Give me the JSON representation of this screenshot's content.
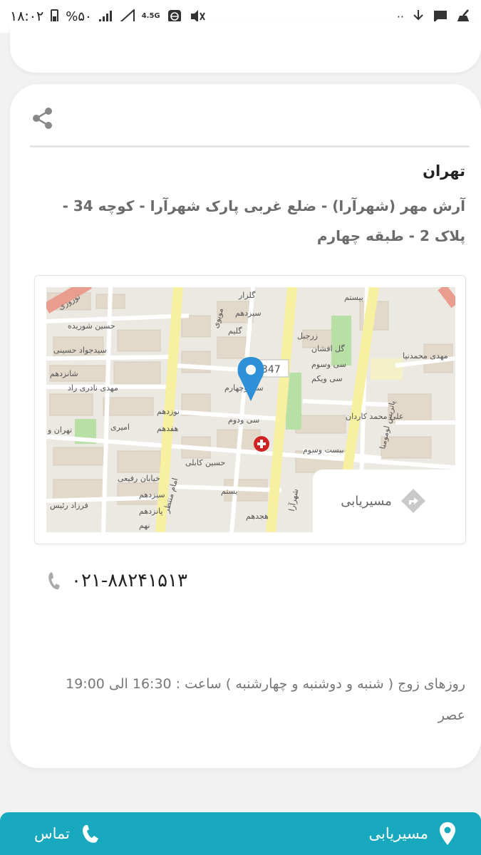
{
  "status_bar": {
    "time": "۱۸:۰۲",
    "battery": "%۵۰",
    "network": "4.5G",
    "extra": "··"
  },
  "card": {
    "city": "تهران",
    "address": "آرش مهر (شهرآرا) - ضلع غربی پارک شهرآرا - کوچه 34 - پلاک 2 - طبقه چهارم",
    "map": {
      "marker_number": "347",
      "streets": [
        "حسین شوریده",
        "سیدجواد حسینی",
        "شانزدهم",
        "مهدی نادری راد",
        "تهران و",
        "امیری",
        "نوزدهم",
        "هفدهم",
        "امام منتظر",
        "سی وچهارم",
        "سی ودوم",
        "حسین کابلی",
        "خیابان رفیعی",
        "فرزاد رئیس",
        "سیزدهم",
        "پانزدهم",
        "نهم",
        "یستم",
        "هجدهم",
        "شهرآرا",
        "بیست وسوم",
        "پاتریس لومومبا",
        "علی محمد کاردان",
        "مهدی محمدنیا",
        "بیستم",
        "گل افشان",
        "سی وسوم",
        "سی ویکم",
        "زرجبل",
        "نوروزی",
        "مویوی",
        "گلزار",
        "سیزدهم",
        "گلیم"
      ],
      "routing_label": "مسیریابی"
    },
    "phone": "۰۲۱-۸۸۲۴۱۵۱۳",
    "hours": "روزهای زوج ( شنبه و دوشنبه و چهارشنبه ) ساعت : 16:30 الی 19:00 عصر"
  },
  "bottom_bar": {
    "call_label": "تماس",
    "routing_label": "مسیریابی"
  },
  "colors": {
    "accent": "#18a9bf",
    "map_road_yellow": "#f6f0a0",
    "map_block": "#e7ddd0",
    "map_park": "#b8dfa6",
    "marker": "#2e90d6"
  }
}
